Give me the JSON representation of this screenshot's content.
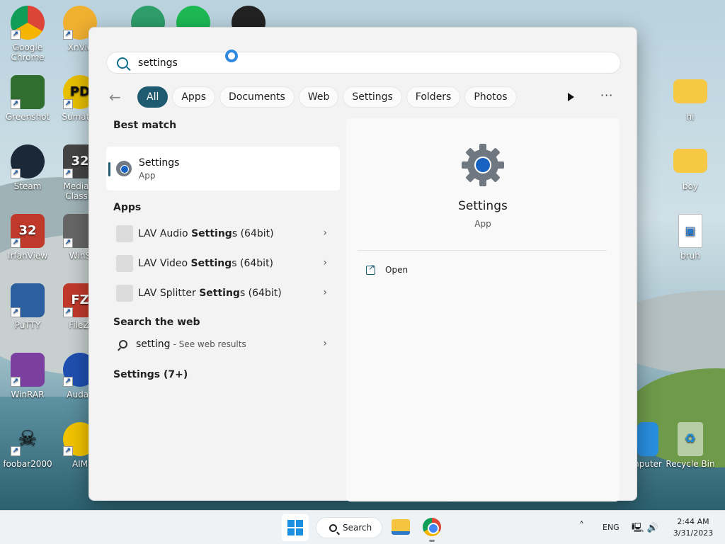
{
  "desktop": {
    "icons_left": [
      {
        "label": "Google Chrome",
        "short": "G",
        "color": "#4285f4"
      },
      {
        "label": "Greenshot",
        "short": "G",
        "color": "#2f6e2f"
      },
      {
        "label": "Steam",
        "short": "S",
        "color": "#1b2838"
      },
      {
        "label": "IrfanView",
        "short": "32",
        "color": "#c0392b"
      },
      {
        "label": "PuTTY",
        "short": "P",
        "color": "#2c5f9e"
      },
      {
        "label": "WinRAR",
        "short": "R",
        "color": "#7b3fa0"
      },
      {
        "label": "foobar2000",
        "short": "f",
        "color": "#ffffff"
      }
    ],
    "icons_second": [
      {
        "label": "XnVie",
        "short": "X",
        "color": "#f0b030"
      },
      {
        "label": "Sumatra",
        "short": "PD",
        "color": "#e8c000"
      },
      {
        "label": "Media P Classic",
        "short": "32",
        "color": "#444444"
      },
      {
        "label": "WinS",
        "short": "W",
        "color": "#666666"
      },
      {
        "label": "FileZi",
        "short": "FZ",
        "color": "#c0392b"
      },
      {
        "label": "Audac",
        "short": "A",
        "color": "#1f4fb0"
      },
      {
        "label": "AIM",
        "short": "A",
        "color": "#f2c300"
      }
    ],
    "icons_right": [
      {
        "label": "hi"
      },
      {
        "label": "boy"
      },
      {
        "label": "bruh"
      }
    ],
    "icons_bottom_right": [
      {
        "label": "mputer"
      },
      {
        "label": "Recycle Bin"
      }
    ]
  },
  "search": {
    "query": "settings"
  },
  "filters": {
    "back": "←",
    "chips": [
      "All",
      "Apps",
      "Documents",
      "Web",
      "Settings",
      "Folders",
      "Photos"
    ],
    "more": "···"
  },
  "results": {
    "best_match_title": "Best match",
    "best_match": {
      "name": "Settings",
      "type": "App"
    },
    "apps_title": "Apps",
    "apps": [
      {
        "pre": "LAV Audio ",
        "bold": "Setting",
        "post": "s (64bit)"
      },
      {
        "pre": "LAV Video ",
        "bold": "Setting",
        "post": "s (64bit)"
      },
      {
        "pre": "LAV Splitter ",
        "bold": "Setting",
        "post": "s (64bit)"
      }
    ],
    "web_title": "Search the web",
    "web": {
      "query": "setting",
      "hint": "- See web results"
    },
    "more_title": "Settings (7+)"
  },
  "preview": {
    "name": "Settings",
    "type": "App",
    "open_label": "Open"
  },
  "taskbar": {
    "search_label": "Search",
    "lang": "ENG",
    "time": "2:44 AM",
    "date": "3/31/2023",
    "accent": "#1f5b70"
  }
}
